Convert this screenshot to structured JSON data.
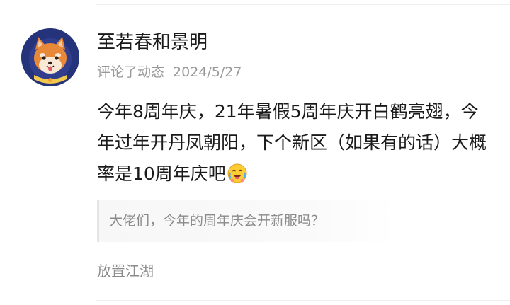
{
  "comment_card": {
    "user": {
      "name": "至若春和景明",
      "avatar_icon": "shiba-dog-astronaut-avatar"
    },
    "meta": {
      "action": "评论了动态",
      "date": "2024/5/27"
    },
    "comment": {
      "text": "今年8周年庆，21年暑假5周年庆开白鹤亮翅，今年过年开丹凤朝阳，下个新区（如果有的话）大概率是10周年庆吧",
      "emoji_icon": "laughing-crying-emoji-icon"
    },
    "quoted_post": {
      "text": "大佬们，今年的周年庆会开新服吗？"
    },
    "source": {
      "label": "放置江湖"
    }
  },
  "colors": {
    "username": "#1a1a1a",
    "meta": "#999999",
    "quote_text": "#8a8a8a",
    "avatar_bg": "#25337a",
    "dog_fur": "#e8893a"
  }
}
